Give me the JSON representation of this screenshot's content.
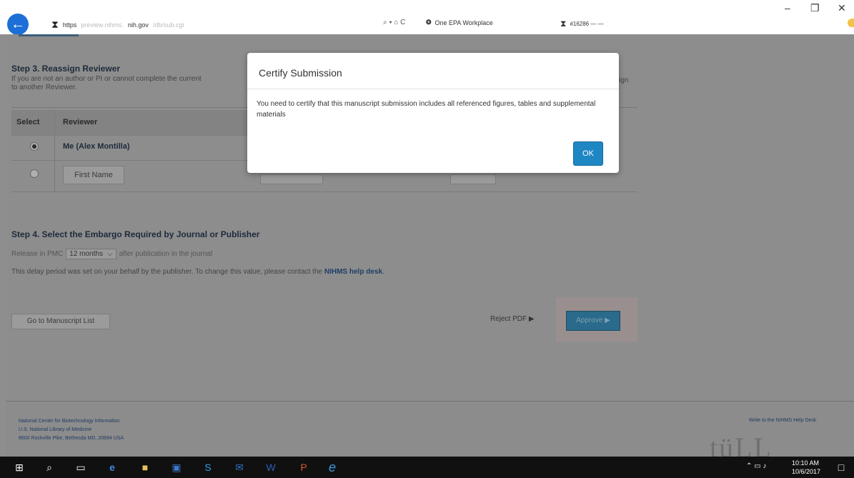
{
  "browser": {
    "url_prefix": "https",
    "url_host_faint": "preview.nihms.",
    "url_host": "nih.gov",
    "url_path": "/db/sub.cgi",
    "search_label": "⌕ ▾ ⌂ C",
    "tab1_title": "One EPA Workplace",
    "tab2_title": "#16286 — —"
  },
  "step3": {
    "heading": "Step 3. Reassign Reviewer",
    "text": "If you are not an author or PI or cannot complete the current",
    "text_tail": "ign",
    "text_line2": "to another Reviewer.",
    "col_select": "Select",
    "col_reviewer": "Reviewer",
    "me_label": "Me (Alex Montilla)",
    "first_name": "First Name"
  },
  "step4": {
    "heading": "Step 4. Select the Embargo Required by Journal or Publisher",
    "release_prefix": "Release in PMC",
    "release_value": "12 months",
    "release_suffix": "after publication in the journal",
    "delay_text": "This delay period was set on your behalf by the publisher. To change this value, please contact the",
    "help_link": "NIHMS help desk",
    "delay_end": "."
  },
  "actions": {
    "goto_list": "Go to Manuscript List",
    "reject": "Reject PDF ▶",
    "approve": "Approve ▶"
  },
  "footer": {
    "line1": "National Center for Biotechnology Information",
    "line2": "U.S. National Library of Medicine",
    "line3": "8600 Rockville Pike, Bethesda MD, 20894 USA",
    "help": "Write to the NIHMS Help Desk",
    "watermark": "tüLL"
  },
  "modal": {
    "title": "Certify Submission",
    "body": "You need to certify that this manuscript submission includes all referenced figures, tables and supplemental materials",
    "ok": "OK"
  },
  "taskbar": {
    "time": "10:10 AM",
    "date": "10/6/2017"
  }
}
